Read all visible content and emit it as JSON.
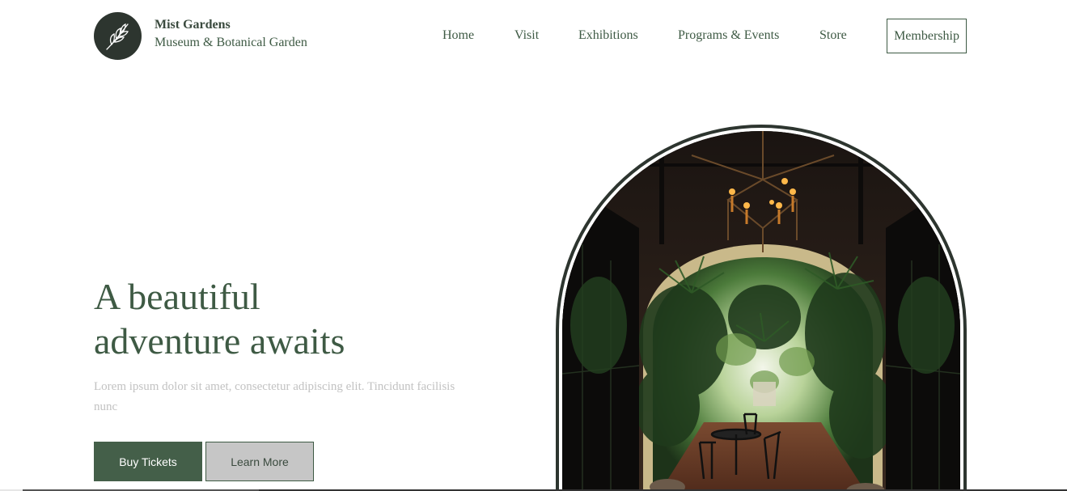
{
  "header": {
    "brand_name": "Mist Gardens",
    "brand_sub": "Museum & Botanical Garden",
    "logo_icon": "leaf-branch-icon",
    "nav": [
      {
        "label": "Home"
      },
      {
        "label": "Visit"
      },
      {
        "label": "Exhibitions"
      },
      {
        "label": "Programs & Events"
      },
      {
        "label": "Store"
      }
    ],
    "membership_label": "Membership"
  },
  "hero": {
    "title_line1": "A beautiful",
    "title_line2": "adventure awaits",
    "description": "Lorem ipsum dolor sit amet, consectetur adipiscing elit. Tincidunt facilisis nunc",
    "buy_label": "Buy Tickets",
    "learn_label": "Learn More"
  },
  "colors": {
    "accent": "#445f49",
    "text": "#3e5a44",
    "dark": "#2d352f",
    "muted": "#c2c2c2",
    "secondary_button": "#c6c6c6"
  }
}
